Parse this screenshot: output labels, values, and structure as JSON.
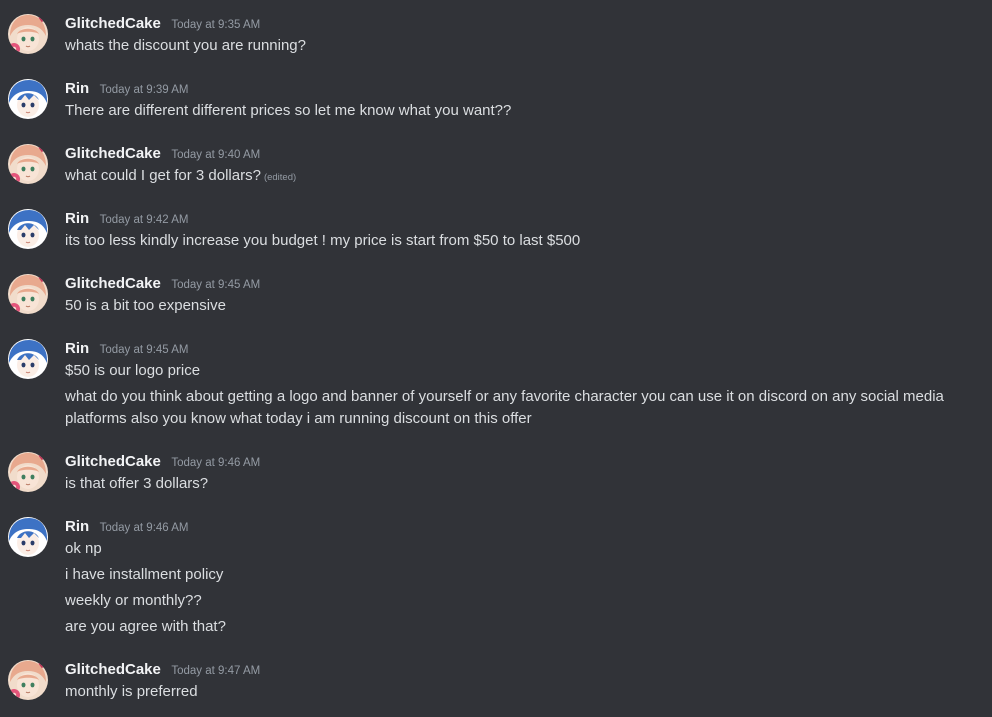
{
  "messages": [
    {
      "author": "GlitchedCake",
      "avatar_icon": "glitchedcake-avatar-icon",
      "timestamp": "Today at 9:35 AM",
      "lines": [
        {
          "text": "whats the discount you are running?"
        }
      ]
    },
    {
      "author": "Rin",
      "avatar_icon": "rin-avatar-icon",
      "timestamp": "Today at 9:39 AM",
      "lines": [
        {
          "text": "There are different different prices so let me know what you want??"
        }
      ]
    },
    {
      "author": "GlitchedCake",
      "avatar_icon": "glitchedcake-avatar-icon",
      "timestamp": "Today at 9:40 AM",
      "lines": [
        {
          "text": "what could I get for 3 dollars?",
          "edited": "(edited)"
        }
      ]
    },
    {
      "author": "Rin",
      "avatar_icon": "rin-avatar-icon",
      "timestamp": "Today at 9:42 AM",
      "lines": [
        {
          "text": "its too less kindly increase you budget ! my price is start from $50 to last $500"
        }
      ]
    },
    {
      "author": "GlitchedCake",
      "avatar_icon": "glitchedcake-avatar-icon",
      "timestamp": "Today at 9:45 AM",
      "lines": [
        {
          "text": "50 is a bit too expensive"
        }
      ]
    },
    {
      "author": "Rin",
      "avatar_icon": "rin-avatar-icon",
      "timestamp": "Today at 9:45 AM",
      "lines": [
        {
          "text": "$50 is our logo price"
        },
        {
          "text": "what do you think about getting a logo and banner of yourself or any favorite character you can use it on discord on any social media platforms also you know what today i am running discount on this offer"
        }
      ]
    },
    {
      "author": "GlitchedCake",
      "avatar_icon": "glitchedcake-avatar-icon",
      "timestamp": "Today at 9:46 AM",
      "lines": [
        {
          "text": "is that offer 3 dollars?"
        }
      ]
    },
    {
      "author": "Rin",
      "avatar_icon": "rin-avatar-icon",
      "timestamp": "Today at 9:46 AM",
      "lines": [
        {
          "text": "ok np"
        },
        {
          "text": "i have installment policy"
        },
        {
          "text": "weekly or monthly??"
        },
        {
          "text": "are you agree with that?"
        }
      ]
    },
    {
      "author": "GlitchedCake",
      "avatar_icon": "glitchedcake-avatar-icon",
      "timestamp": "Today at 9:47 AM",
      "lines": [
        {
          "text": "monthly is preferred"
        }
      ]
    }
  ]
}
